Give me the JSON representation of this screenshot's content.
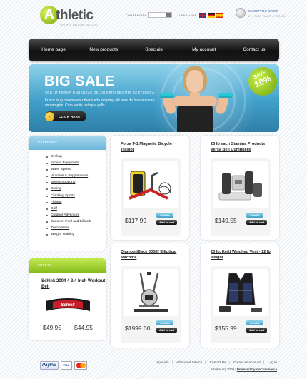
{
  "header": {
    "logo_letter": "A",
    "logo_word": "thletic",
    "tagline": "SPORT ONLINE STORE",
    "currencies_label": "CURRENCIES:",
    "language_label": "LANGUAGE:",
    "cart_title": "SHOPPING CART:",
    "cart_status": "IN YOUR CART 0 ITEMS",
    "flags": [
      "flag-uk-icon",
      "flag-de-icon",
      "flag-es-icon"
    ]
  },
  "nav": {
    "items": [
      "Home page",
      "New products",
      "Specials",
      "My account",
      "Contact us"
    ]
  },
  "banner": {
    "title": "BIG SALE",
    "subtitle": "SED UT PERSP. UNNANSAS DELER KRITASEA NTE KERTSDERA",
    "description": "Fusce feug malesuada orberis eda scripting elit tene de fusera dolore veresh glits. Cum sociis natoque pells",
    "button_label": "CLICK HERE",
    "badge_top": "SAVE",
    "badge_value": "10%"
  },
  "sidebar": {
    "category_title": "CATEGORY",
    "categories": [
      "Cycling",
      "Fitness Equipment",
      "Water Sports",
      "Vitamins & Supplements",
      "Sports Supports",
      "Boxing",
      "Climbing Sports",
      "Fishing",
      "Golf",
      "Outdoor Adventure",
      "Snooker, Pool and Billiards",
      "Trampolines",
      "Weight Training"
    ],
    "special_title": "SPECIAL",
    "special_product": {
      "name": "Schiek 2004 4 3/4 Inch Workout Belt",
      "price_old": "$49.95",
      "price_new": "$44.95"
    }
  },
  "products": [
    {
      "name": "Forza F-1 Magnetic Bicycle Trainor",
      "price": "$117.99",
      "details": "Details",
      "add": "Add to cart"
    },
    {
      "name": "25 lb each Stamina Products Versa Bell Dumbbells",
      "price": "$149.55",
      "details": "Details",
      "add": "Add to cart"
    },
    {
      "name": "DiamondBack 500Ef Elliptical Machine",
      "price": "$1999.00",
      "details": "Details",
      "add": "Add to cart"
    },
    {
      "name": "20 lb. Kettl Weighed Vest - 12 lb weight",
      "price": "$155.99",
      "details": "Details",
      "add": "Add to cart"
    }
  ],
  "footer": {
    "links": [
      "Specials",
      "Advanced Search",
      "Contact Us",
      "Create an Account",
      "Log In"
    ],
    "copyright": "Athletic (c) 2009",
    "powered": "Powered by osCommerce",
    "paypal": "PayPal",
    "visa": "VISA"
  },
  "colors": {
    "accent_green": "#86bb1c",
    "accent_blue": "#3f9fc9",
    "nav_dark": "#111111"
  }
}
